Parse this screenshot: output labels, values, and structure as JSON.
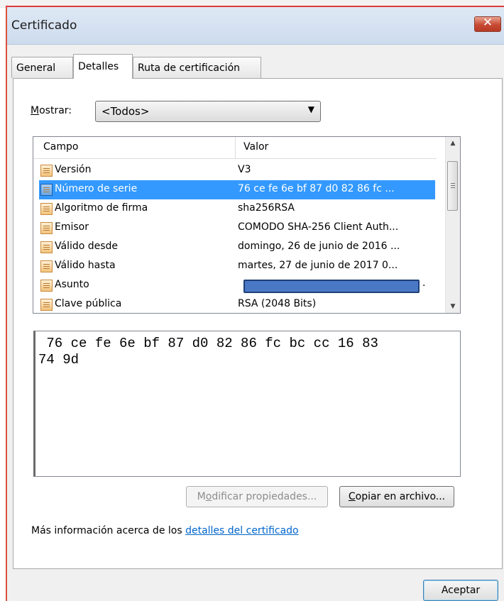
{
  "window": {
    "title": "Certificado"
  },
  "tabs": [
    {
      "label": "General"
    },
    {
      "label": "Detalles"
    },
    {
      "label": "Ruta de certificación"
    }
  ],
  "show": {
    "label_mnemonic": "M",
    "label_rest": "ostrar:",
    "selected": "<Todos>"
  },
  "list": {
    "headers": {
      "field": "Campo",
      "value": "Valor"
    },
    "rows": [
      {
        "field": "Versión",
        "value": "V3"
      },
      {
        "field": "Número de serie",
        "value": "76 ce fe 6e bf 87 d0 82 86 fc ..."
      },
      {
        "field": "Algoritmo de firma",
        "value": "sha256RSA"
      },
      {
        "field": "Emisor",
        "value": "COMODO SHA-256 Client Auth..."
      },
      {
        "field": "Válido desde",
        "value": "domingo, 26 de junio de 2016 ..."
      },
      {
        "field": "Válido hasta",
        "value": "martes, 27 de junio de 2017 0..."
      },
      {
        "field": "Asunto",
        "value": "."
      },
      {
        "field": "Clave pública",
        "value": "RSA (2048 Bits)"
      }
    ],
    "selected_index": 1
  },
  "detail": {
    "text": " 76 ce fe 6e bf 87 d0 82 86 fc bc cc 16 83\n74 9d"
  },
  "buttons": {
    "edit_pre": "M",
    "edit_mnemonic": "o",
    "edit_post": "dificar propiedades...",
    "copy_mnemonic": "C",
    "copy_post": "opiar en archivo...",
    "ok": "Aceptar"
  },
  "info": {
    "text": "Más información acerca de los ",
    "link": "detalles del certificado"
  },
  "colors": {
    "selection": "#3399ff",
    "link": "#0066cc",
    "redaction": "#4a78c4"
  }
}
